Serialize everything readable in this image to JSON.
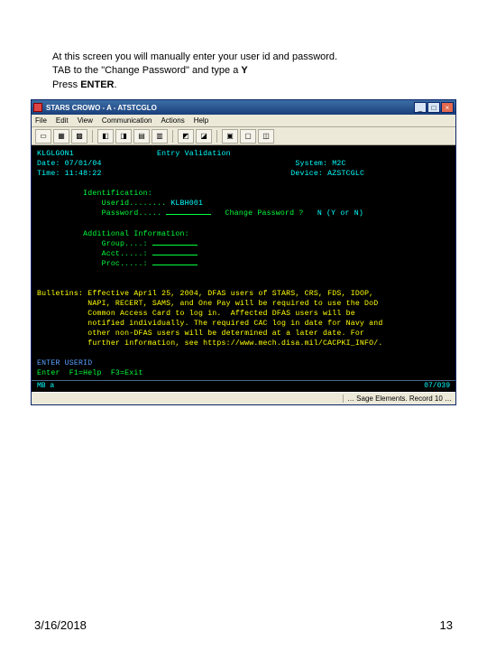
{
  "instructions": {
    "line1": "At this screen you will manually enter your user id and password.",
    "line2a": "TAB to the \"Change Password\" and type a ",
    "line2b": "Y",
    "line3a": "Press ",
    "line3b": "ENTER",
    "line3c": "."
  },
  "window": {
    "title": "STARS CROWO - A - ATSTCGLO",
    "menus": [
      "File",
      "Edit",
      "View",
      "Communication",
      "Actions",
      "Help"
    ],
    "min": "_",
    "max": "□",
    "close": "×",
    "status_right": "07/039",
    "status_left": "MB    a",
    "bottom_status": "… Sage Elements. Record 10 …"
  },
  "term": {
    "header_left_id": "KLGLGON1",
    "header_center": "Entry Validation",
    "header_right1": "System: M2C",
    "date_label": "Date: 07/01/04",
    "time_label": "Time: 11:48:22",
    "device_label": "Device: AZSTCGLC",
    "identification_label": "Identification:",
    "userid_label": "Userid........",
    "userid_value": "KLBH001",
    "password_label": "Password.....",
    "change_pw_label": "Change Password ?",
    "change_pw_hint": "N (Y or N)",
    "additional_label": "Additional Information:",
    "group_label": "Group....:",
    "acct_label": "Acct.....:",
    "proc_label": "Proc.....:",
    "bulletin_label": "Bulletins:",
    "bulletin_text": "Effective April 25, 2004, DFAS users of STARS, CRS, FDS, IDOP,\n           NAPI, RECERT, SAMS, and One Pay will be required to use the DoD\n           Common Access Card to log in.  Affected DFAS users will be\n           notified individually. The required CAC log in date for Navy and\n           other non-DFAS users will be determined at a later date. For\n           further information, see https://www.mech.disa.mil/CACPKI_INFO/.",
    "prompt": "ENTER USERID",
    "help_line": "Enter  F1=Help  F3=Exit"
  },
  "footer": {
    "date": "3/16/2018",
    "page": "13"
  }
}
